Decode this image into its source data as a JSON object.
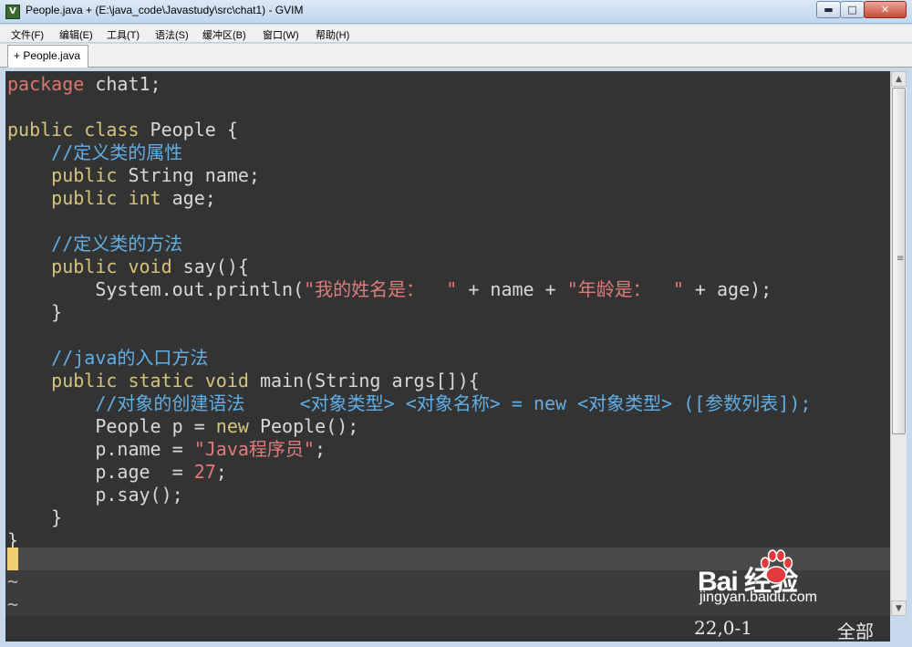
{
  "window": {
    "title": "People.java + (E:\\java_code\\Javastudy\\src\\chat1) - GVIM",
    "icon": "gvim-icon",
    "minimize_glyph": "▬",
    "maximize_glyph": "□",
    "close_glyph": "✕"
  },
  "menu": [
    "文件(F)",
    "编辑(E)",
    "工具(T)",
    "语法(S)",
    "缓冲区(B)",
    "窗口(W)",
    "帮助(H)"
  ],
  "tabs": [
    {
      "label": "+ People.java"
    }
  ],
  "code": {
    "lines": [
      [
        [
          "package",
          "pkg"
        ],
        [
          " chat1;",
          "id"
        ]
      ],
      [],
      [
        [
          "public",
          "kw"
        ],
        [
          " ",
          "id"
        ],
        [
          "class",
          "kw"
        ],
        [
          " People {",
          "id"
        ]
      ],
      [
        [
          "    //定义类的属性",
          "cmt"
        ]
      ],
      [
        [
          "    ",
          "id"
        ],
        [
          "public",
          "kw"
        ],
        [
          " String name;",
          "id"
        ]
      ],
      [
        [
          "    ",
          "id"
        ],
        [
          "public",
          "kw"
        ],
        [
          " ",
          "id"
        ],
        [
          "int",
          "kw"
        ],
        [
          " age;",
          "id"
        ]
      ],
      [],
      [
        [
          "    //定义类的方法",
          "cmt"
        ]
      ],
      [
        [
          "    ",
          "id"
        ],
        [
          "public",
          "kw"
        ],
        [
          " ",
          "id"
        ],
        [
          "void",
          "kw"
        ],
        [
          " say(){",
          "id"
        ]
      ],
      [
        [
          "        System.out.println(",
          "id"
        ],
        [
          "\"我的姓名是：  \"",
          "str"
        ],
        [
          " + name + ",
          "id"
        ],
        [
          "\"年龄是：  \"",
          "str"
        ],
        [
          " + age);",
          "id"
        ]
      ],
      [
        [
          "    }",
          "id"
        ]
      ],
      [],
      [
        [
          "    //java的入口方法",
          "cmt"
        ]
      ],
      [
        [
          "    ",
          "id"
        ],
        [
          "public",
          "kw"
        ],
        [
          " ",
          "id"
        ],
        [
          "static",
          "kw"
        ],
        [
          " ",
          "id"
        ],
        [
          "void",
          "kw"
        ],
        [
          " main(String args[]){",
          "id"
        ]
      ],
      [
        [
          "        //对象的创建语法     <对象类型> <对象名称> = new <对象类型> ([参数列表]);",
          "cmt"
        ]
      ],
      [
        [
          "        People p = ",
          "id"
        ],
        [
          "new",
          "kw"
        ],
        [
          " People();",
          "id"
        ]
      ],
      [
        [
          "        p.name = ",
          "id"
        ],
        [
          "\"Java程序员\"",
          "str"
        ],
        [
          ";",
          "id"
        ]
      ],
      [
        [
          "        p.age  = ",
          "id"
        ],
        [
          "27",
          "num"
        ],
        [
          ";",
          "id"
        ]
      ],
      [
        [
          "        p.say();",
          "id"
        ]
      ],
      [
        [
          "    }",
          "id"
        ]
      ],
      [
        [
          "}",
          "id"
        ]
      ]
    ],
    "tildes": [
      "~",
      "~"
    ]
  },
  "status": {
    "position": "22,0-1",
    "percent": "全部"
  },
  "scrollbar": {
    "up_glyph": "▲",
    "down_glyph": "▼",
    "grip_glyph": "≡"
  },
  "watermark": {
    "logo": "Bai  经验",
    "url": "jingyan.baidu.com"
  }
}
